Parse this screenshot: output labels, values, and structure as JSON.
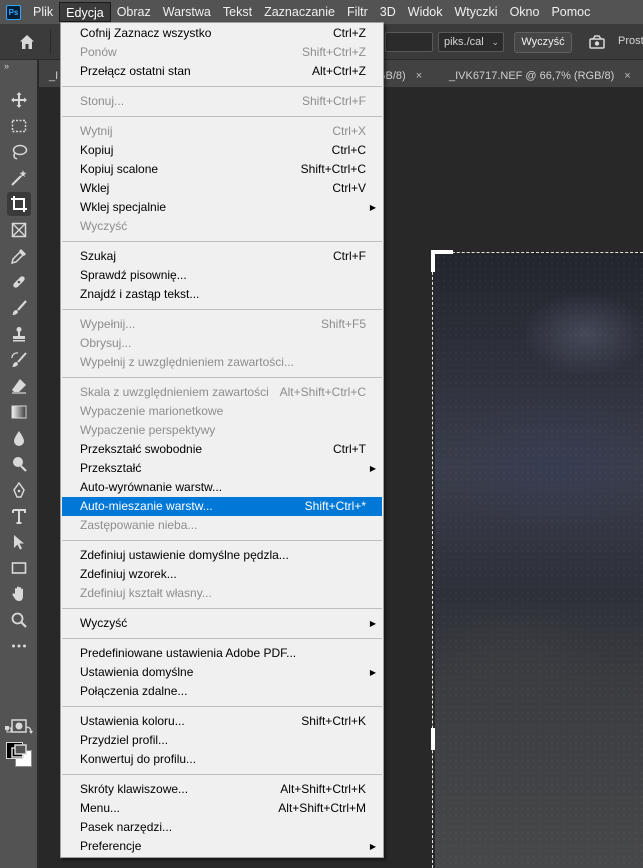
{
  "menubar": {
    "logo": "Ps",
    "items": [
      "Plik",
      "Edycja",
      "Obraz",
      "Warstwa",
      "Tekst",
      "Zaznaczanie",
      "Filtr",
      "3D",
      "Widok",
      "Wtyczki",
      "Okno",
      "Pomoc"
    ],
    "active_index": 1
  },
  "options": {
    "unit_value": "piks./cal",
    "clear_label": "Wyczyść",
    "straighten_partial": "Prost"
  },
  "tabs": {
    "tab1": "_I",
    "tab2_partial": "RGB/8)",
    "tab3": "_IVK6717.NEF @ 66,7% (RGB/8)",
    "close_glyph": "×"
  },
  "toolbar": {
    "collapse_glyph": "»",
    "tools": [
      "move-tool",
      "marquee-tool",
      "lasso-tool",
      "magic-wand-tool",
      "crop-tool",
      "frame-tool",
      "eyedropper-tool",
      "healing-brush-tool",
      "brush-tool",
      "clone-stamp-tool",
      "history-brush-tool",
      "eraser-tool",
      "gradient-tool",
      "blur-tool",
      "dodge-tool",
      "pen-tool",
      "type-tool",
      "path-selection-tool",
      "rectangle-tool",
      "hand-tool",
      "zoom-tool",
      "more-tools",
      "quick-mask",
      "screen-mode"
    ],
    "active_tool": "crop-tool",
    "foreground_color": "#000000",
    "background_color": "#ffffff"
  },
  "edit_menu": {
    "groups": [
      [
        {
          "label": "Cofnij Zaznacz wszystko",
          "shortcut": "Ctrl+Z",
          "disabled": false
        },
        {
          "label": "Ponów",
          "shortcut": "Shift+Ctrl+Z",
          "disabled": true
        },
        {
          "label": "Przełącz ostatni stan",
          "shortcut": "Alt+Ctrl+Z",
          "disabled": false
        }
      ],
      [
        {
          "label": "Stonuj...",
          "shortcut": "Shift+Ctrl+F",
          "disabled": true
        }
      ],
      [
        {
          "label": "Wytnij",
          "shortcut": "Ctrl+X",
          "disabled": true
        },
        {
          "label": "Kopiuj",
          "shortcut": "Ctrl+C",
          "disabled": false
        },
        {
          "label": "Kopiuj scalone",
          "shortcut": "Shift+Ctrl+C",
          "disabled": false
        },
        {
          "label": "Wklej",
          "shortcut": "Ctrl+V",
          "disabled": false
        },
        {
          "label": "Wklej specjalnie",
          "shortcut": "",
          "submenu": true,
          "disabled": false
        },
        {
          "label": "Wyczyść",
          "shortcut": "",
          "disabled": true
        }
      ],
      [
        {
          "label": "Szukaj",
          "shortcut": "Ctrl+F",
          "disabled": false
        },
        {
          "label": "Sprawdź pisownię...",
          "shortcut": "",
          "disabled": false
        },
        {
          "label": "Znajdź i zastąp tekst...",
          "shortcut": "",
          "disabled": false
        }
      ],
      [
        {
          "label": "Wypełnij...",
          "shortcut": "Shift+F5",
          "disabled": true
        },
        {
          "label": "Obrysuj...",
          "shortcut": "",
          "disabled": true
        },
        {
          "label": "Wypełnij z uwzględnieniem zawartości...",
          "shortcut": "",
          "disabled": true
        }
      ],
      [
        {
          "label": "Skala z uwzględnieniem zawartości",
          "shortcut": "Alt+Shift+Ctrl+C",
          "disabled": true
        },
        {
          "label": "Wypaczenie marionetkowe",
          "shortcut": "",
          "disabled": true
        },
        {
          "label": "Wypaczenie perspektywy",
          "shortcut": "",
          "disabled": true
        },
        {
          "label": "Przekształć swobodnie",
          "shortcut": "Ctrl+T",
          "disabled": false
        },
        {
          "label": "Przekształć",
          "shortcut": "",
          "submenu": true,
          "disabled": false
        },
        {
          "label": "Auto-wyrównanie warstw...",
          "shortcut": "",
          "disabled": false
        },
        {
          "label": "Auto-mieszanie warstw...",
          "shortcut": "Shift+Ctrl+*",
          "disabled": false,
          "highlighted": true
        },
        {
          "label": "Zastępowanie nieba...",
          "shortcut": "",
          "disabled": true
        }
      ],
      [
        {
          "label": "Zdefiniuj ustawienie domyślne pędzla...",
          "shortcut": "",
          "disabled": false
        },
        {
          "label": "Zdefiniuj wzorek...",
          "shortcut": "",
          "disabled": false
        },
        {
          "label": "Zdefiniuj kształt własny...",
          "shortcut": "",
          "disabled": true
        }
      ],
      [
        {
          "label": "Wyczyść",
          "shortcut": "",
          "submenu": true,
          "disabled": false
        }
      ],
      [
        {
          "label": "Predefiniowane ustawienia Adobe PDF...",
          "shortcut": "",
          "disabled": false
        },
        {
          "label": "Ustawienia domyślne",
          "shortcut": "",
          "submenu": true,
          "disabled": false
        },
        {
          "label": "Połączenia zdalne...",
          "shortcut": "",
          "disabled": false
        }
      ],
      [
        {
          "label": "Ustawienia koloru...",
          "shortcut": "Shift+Ctrl+K",
          "disabled": false
        },
        {
          "label": "Przydziel profil...",
          "shortcut": "",
          "disabled": false
        },
        {
          "label": "Konwertuj do profilu...",
          "shortcut": "",
          "disabled": false
        }
      ],
      [
        {
          "label": "Skróty klawiszowe...",
          "shortcut": "Alt+Shift+Ctrl+K",
          "disabled": false
        },
        {
          "label": "Menu...",
          "shortcut": "Alt+Shift+Ctrl+M",
          "disabled": false
        },
        {
          "label": "Pasek narzędzi...",
          "shortcut": "",
          "disabled": false
        },
        {
          "label": "Preferencje",
          "shortcut": "",
          "submenu": true,
          "disabled": false
        }
      ]
    ]
  },
  "colors": {
    "highlight": "#0078d7",
    "menu_bg": "#f0f0f0",
    "chrome": "#535353"
  }
}
